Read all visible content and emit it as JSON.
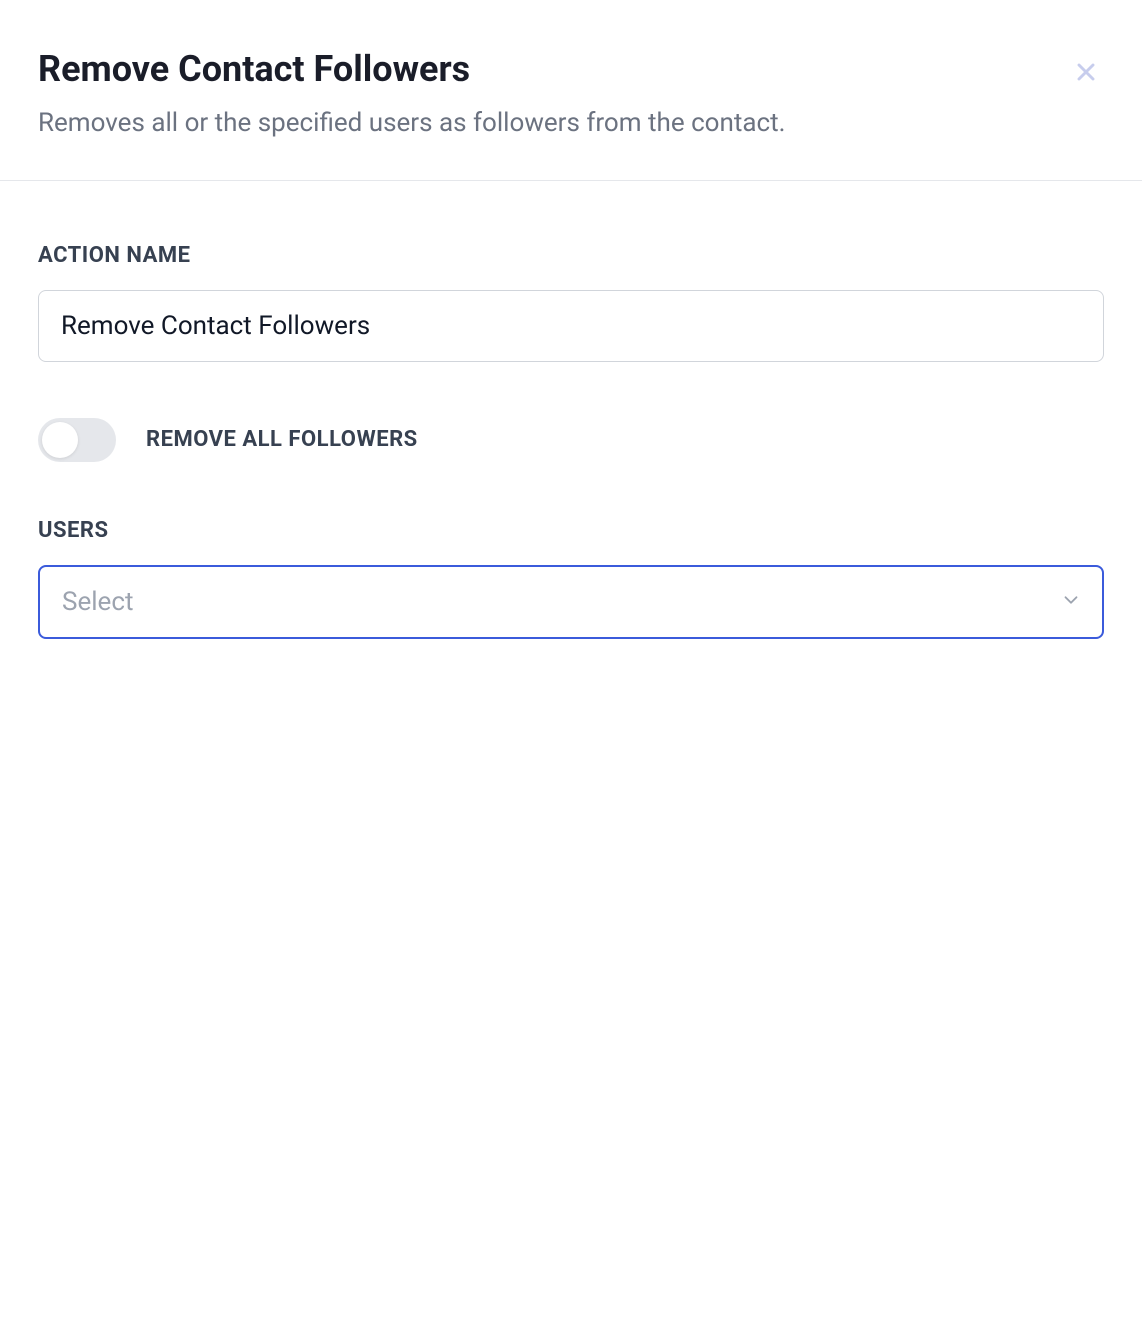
{
  "header": {
    "title": "Remove Contact Followers",
    "subtitle": "Removes all or the specified users as followers from the contact."
  },
  "form": {
    "action_name": {
      "label": "ACTION NAME",
      "value": "Remove Contact Followers"
    },
    "remove_all_toggle": {
      "label": "REMOVE ALL FOLLOWERS",
      "enabled": false
    },
    "users": {
      "label": "USERS",
      "placeholder": "Select"
    }
  }
}
